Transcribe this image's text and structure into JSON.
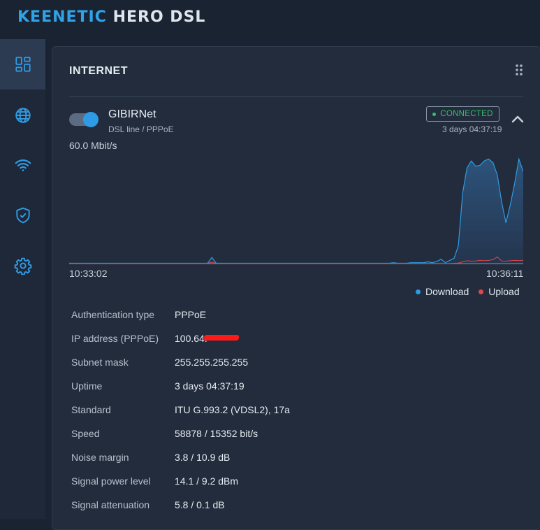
{
  "app": {
    "brand_part1": "KEENETIC",
    "brand_part2": "HERO DSL",
    "brand_color": "#2fa3e8",
    "accent_color": "#2f9be4"
  },
  "sidebar": {
    "items": [
      {
        "icon": "dashboard-icon",
        "active": true
      },
      {
        "icon": "globe-icon",
        "active": false
      },
      {
        "icon": "wifi-icon",
        "active": false
      },
      {
        "icon": "shield-icon",
        "active": false
      },
      {
        "icon": "gear-icon",
        "active": false
      }
    ]
  },
  "card": {
    "title": "INTERNET",
    "connection": {
      "name": "GIBIRNet",
      "subtitle": "DSL line / PPPoE",
      "enabled": true,
      "status": "CONNECTED",
      "status_color": "#34c06a",
      "uptime": "3 days 04:37:19"
    }
  },
  "chart_data": {
    "type": "area",
    "y_max_label": "60.0 Mbit/s",
    "x_start_label": "10:33:02",
    "x_end_label": "10:36:11",
    "ylim": [
      0,
      60
    ],
    "series": [
      {
        "name": "Download",
        "color": "#2f9be4",
        "values": [
          0.2,
          0.2,
          0.2,
          0.2,
          0.2,
          0.2,
          0.2,
          0.2,
          0.2,
          0.2,
          0.2,
          0.2,
          0.2,
          0.2,
          0.2,
          0.2,
          0.2,
          0.2,
          0.2,
          0.2,
          0.2,
          0.2,
          0.2,
          0.2,
          0.2,
          0.2,
          0.2,
          0.2,
          0.2,
          0.2,
          0.2,
          0.2,
          0.2,
          3.5,
          0.2,
          0.2,
          0.2,
          0.2,
          0.2,
          0.2,
          0.2,
          0.2,
          0.2,
          0.2,
          0.2,
          0.2,
          0.2,
          0.2,
          0.2,
          0.2,
          0.2,
          0.2,
          0.2,
          0.2,
          0.2,
          0.2,
          0.2,
          0.2,
          0.2,
          0.2,
          0.2,
          0.2,
          0.2,
          0.2,
          0.2,
          0.2,
          0.2,
          0.2,
          0.2,
          0.2,
          0.2,
          0.2,
          0.2,
          0.2,
          0.2,
          0.5,
          0.2,
          0.2,
          0.2,
          0.5,
          0.5,
          0.5,
          0.5,
          1.0,
          0.5,
          1.2,
          2.5,
          0.5,
          1.8,
          3.0,
          10.0,
          40.0,
          54.0,
          58.0,
          55.0,
          55.5,
          58.0,
          59.0,
          57.0,
          50.0,
          35.0,
          23.0,
          33.0,
          45.0,
          59.0,
          52.0
        ]
      },
      {
        "name": "Upload",
        "color": "#e0474c",
        "values": [
          0.1,
          0.1,
          0.1,
          0.1,
          0.1,
          0.1,
          0.1,
          0.1,
          0.1,
          0.1,
          0.1,
          0.1,
          0.1,
          0.1,
          0.1,
          0.1,
          0.1,
          0.1,
          0.1,
          0.1,
          0.1,
          0.1,
          0.1,
          0.1,
          0.1,
          0.1,
          0.1,
          0.1,
          0.1,
          0.1,
          0.1,
          0.1,
          0.1,
          0.8,
          0.1,
          0.1,
          0.1,
          0.1,
          0.1,
          0.1,
          0.1,
          0.1,
          0.1,
          0.1,
          0.1,
          0.1,
          0.1,
          0.1,
          0.1,
          0.1,
          0.1,
          0.1,
          0.1,
          0.1,
          0.1,
          0.1,
          0.1,
          0.1,
          0.1,
          0.1,
          0.1,
          0.1,
          0.1,
          0.1,
          0.1,
          0.1,
          0.1,
          0.1,
          0.1,
          0.1,
          0.1,
          0.1,
          0.1,
          0.1,
          0.1,
          0.1,
          0.1,
          0.1,
          0.1,
          0.1,
          0.1,
          0.1,
          0.1,
          0.1,
          0.1,
          0.1,
          0.1,
          0.1,
          0.1,
          0.2,
          0.3,
          1.0,
          1.6,
          1.4,
          1.5,
          1.8,
          1.6,
          1.8,
          2.2,
          3.8,
          1.5,
          1.4,
          1.6,
          1.8,
          1.7,
          1.8
        ]
      }
    ],
    "legend": [
      "Download",
      "Upload"
    ],
    "legend_position": "bottom-right",
    "grid": false
  },
  "details": [
    {
      "label": "Authentication type",
      "value": "PPPoE"
    },
    {
      "label": "IP address (PPPoE)",
      "value": "100.64.",
      "redacted": true
    },
    {
      "label": "Subnet mask",
      "value": "255.255.255.255"
    },
    {
      "label": "Uptime",
      "value": "3 days 04:37:19"
    },
    {
      "label": "Standard",
      "value": "ITU G.993.2 (VDSL2), 17a"
    },
    {
      "label": "Speed",
      "value": "58878 / 15352 bit/s"
    },
    {
      "label": "Noise margin",
      "value": "3.8 / 10.9 dB"
    },
    {
      "label": "Signal power level",
      "value": "14.1 / 9.2 dBm"
    },
    {
      "label": "Signal attenuation",
      "value": "5.8 / 0.1 dB"
    }
  ]
}
